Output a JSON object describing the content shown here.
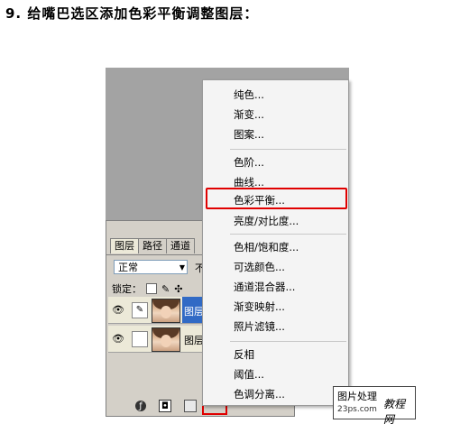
{
  "title": "9. 给嘴巴选区添加色彩平衡调整图层：",
  "layers_panel": {
    "tabs": [
      "图层",
      "路径",
      "通道"
    ],
    "blend_mode": "正常",
    "opacity_label": "不",
    "lock_label": "锁定：",
    "layers": [
      {
        "name": "图层"
      },
      {
        "name": "图层"
      }
    ]
  },
  "menu": {
    "items": [
      "纯色...",
      "渐变...",
      "图案...",
      "色阶...",
      "曲线...",
      "色彩平衡...",
      "亮度/对比度...",
      "色相/饱和度...",
      "可选颜色...",
      "通道混合器...",
      "渐变映射...",
      "照片滤镜...",
      "反相",
      "阈值...",
      "色调分离..."
    ],
    "highlighted": "色彩平衡..."
  },
  "watermark": {
    "top": "图片处理",
    "sub": "23ps.com",
    "big": "教程网"
  },
  "colors": {
    "highlight_red": "#e00000",
    "selected_layer": "#316ac5"
  }
}
